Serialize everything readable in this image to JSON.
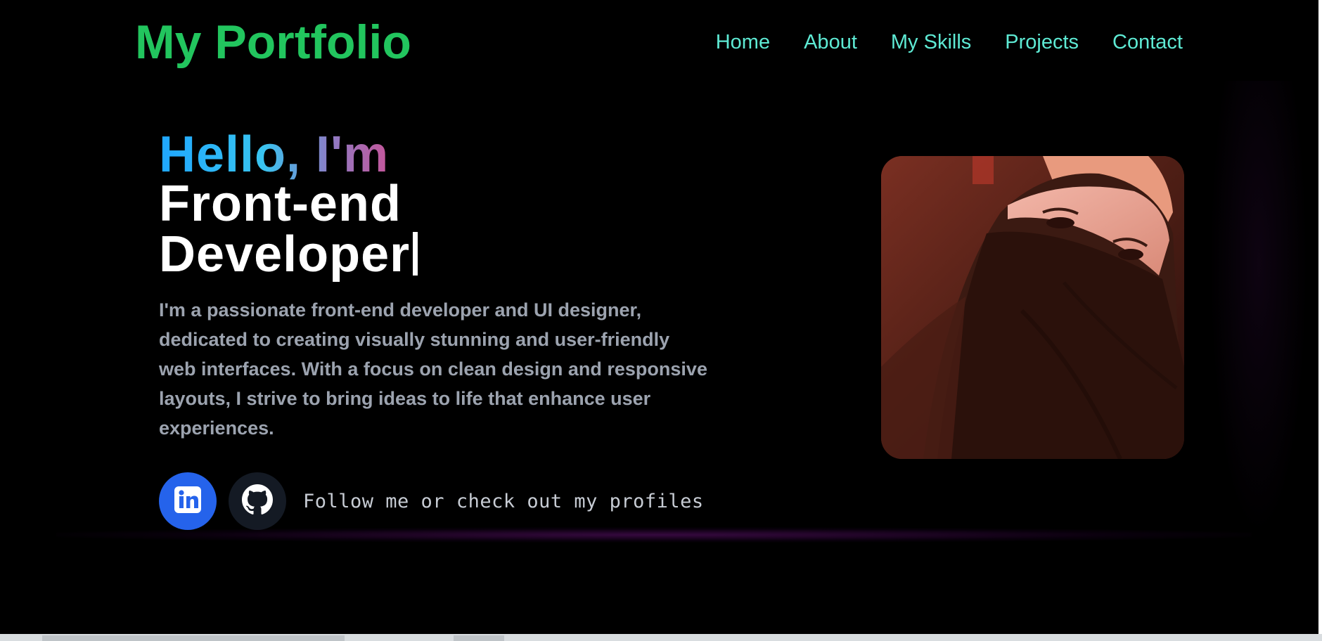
{
  "header": {
    "logo": "My Portfolio",
    "nav": [
      {
        "label": "Home"
      },
      {
        "label": "About"
      },
      {
        "label": "My Skills"
      },
      {
        "label": "Projects"
      },
      {
        "label": "Contact"
      }
    ]
  },
  "hero": {
    "greeting": "Hello, I'm",
    "role_line1": "Front-end",
    "role_line2": "Developer",
    "description": "I'm a passionate front-end developer and UI designer, dedicated to creating visually stunning and user-friendly web interfaces. With a focus on clean design and responsive layouts, I strive to bring ideas to life that enhance user experiences.",
    "follow_text": "Follow me or check out my profiles"
  },
  "social": {
    "linkedin_icon": "linkedin-icon",
    "github_icon": "github-icon"
  },
  "colors": {
    "logo": "#22c55e",
    "nav": "#5eead4",
    "linkedin_bg": "#2563eb",
    "github_bg": "#141a24",
    "description": "#9ca3af"
  }
}
